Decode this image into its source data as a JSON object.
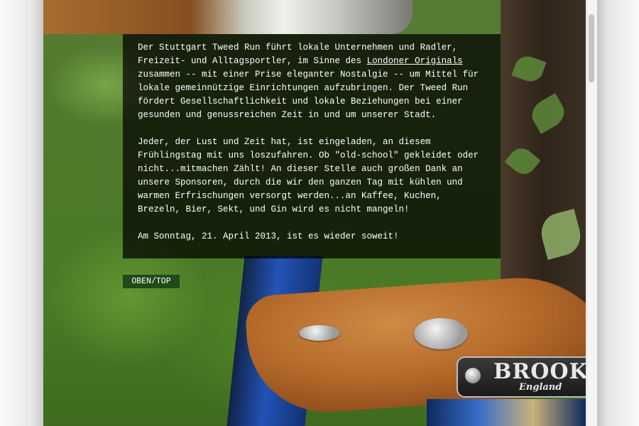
{
  "content": {
    "paragraph1": {
      "before_link": "Der Stuttgart Tweed Run führt lokale Unternehmen und Radler, Freizeit- und Alltagsportler, im Sinne des ",
      "link_text": "Londoner Originals",
      "after_link": " zusammen -- mit einer Prise eleganter Nostalgie -- um Mittel für lokale gemeinnützige Einrichtungen aufzubringen. Der Tweed Run fördert Gesellschaftlichkeit und lokale Beziehungen bei einer gesunden und genussreichen Zeit in und um unserer Stadt."
    },
    "paragraph2": "Jeder, der Lust und Zeit hat, ist eingeladen, an diesem Frühlingstag mit uns loszufahren. Ob \"old-school\" gekleidet oder nicht...mitmachen Zählt! An dieser Stelle auch großen Dank an unsere Sponsoren, durch die wir den ganzen Tag mit kühlen und warmen Erfrischungen versorgt werden...an Kaffee, Kuchen, Brezeln, Bier, Sekt, und Gin wird es nicht mangeln!",
    "paragraph3": "Am Sonntag, 21. April 2013, ist es wieder soweit!"
  },
  "top_button": {
    "label": "OBEN/TOP"
  },
  "background_photo": {
    "brand": "BROOKS",
    "brand_sub": "England"
  },
  "colors": {
    "text_box_bg": "#000000",
    "button_bg": "#1f4a1a",
    "text": "#ffffff"
  }
}
